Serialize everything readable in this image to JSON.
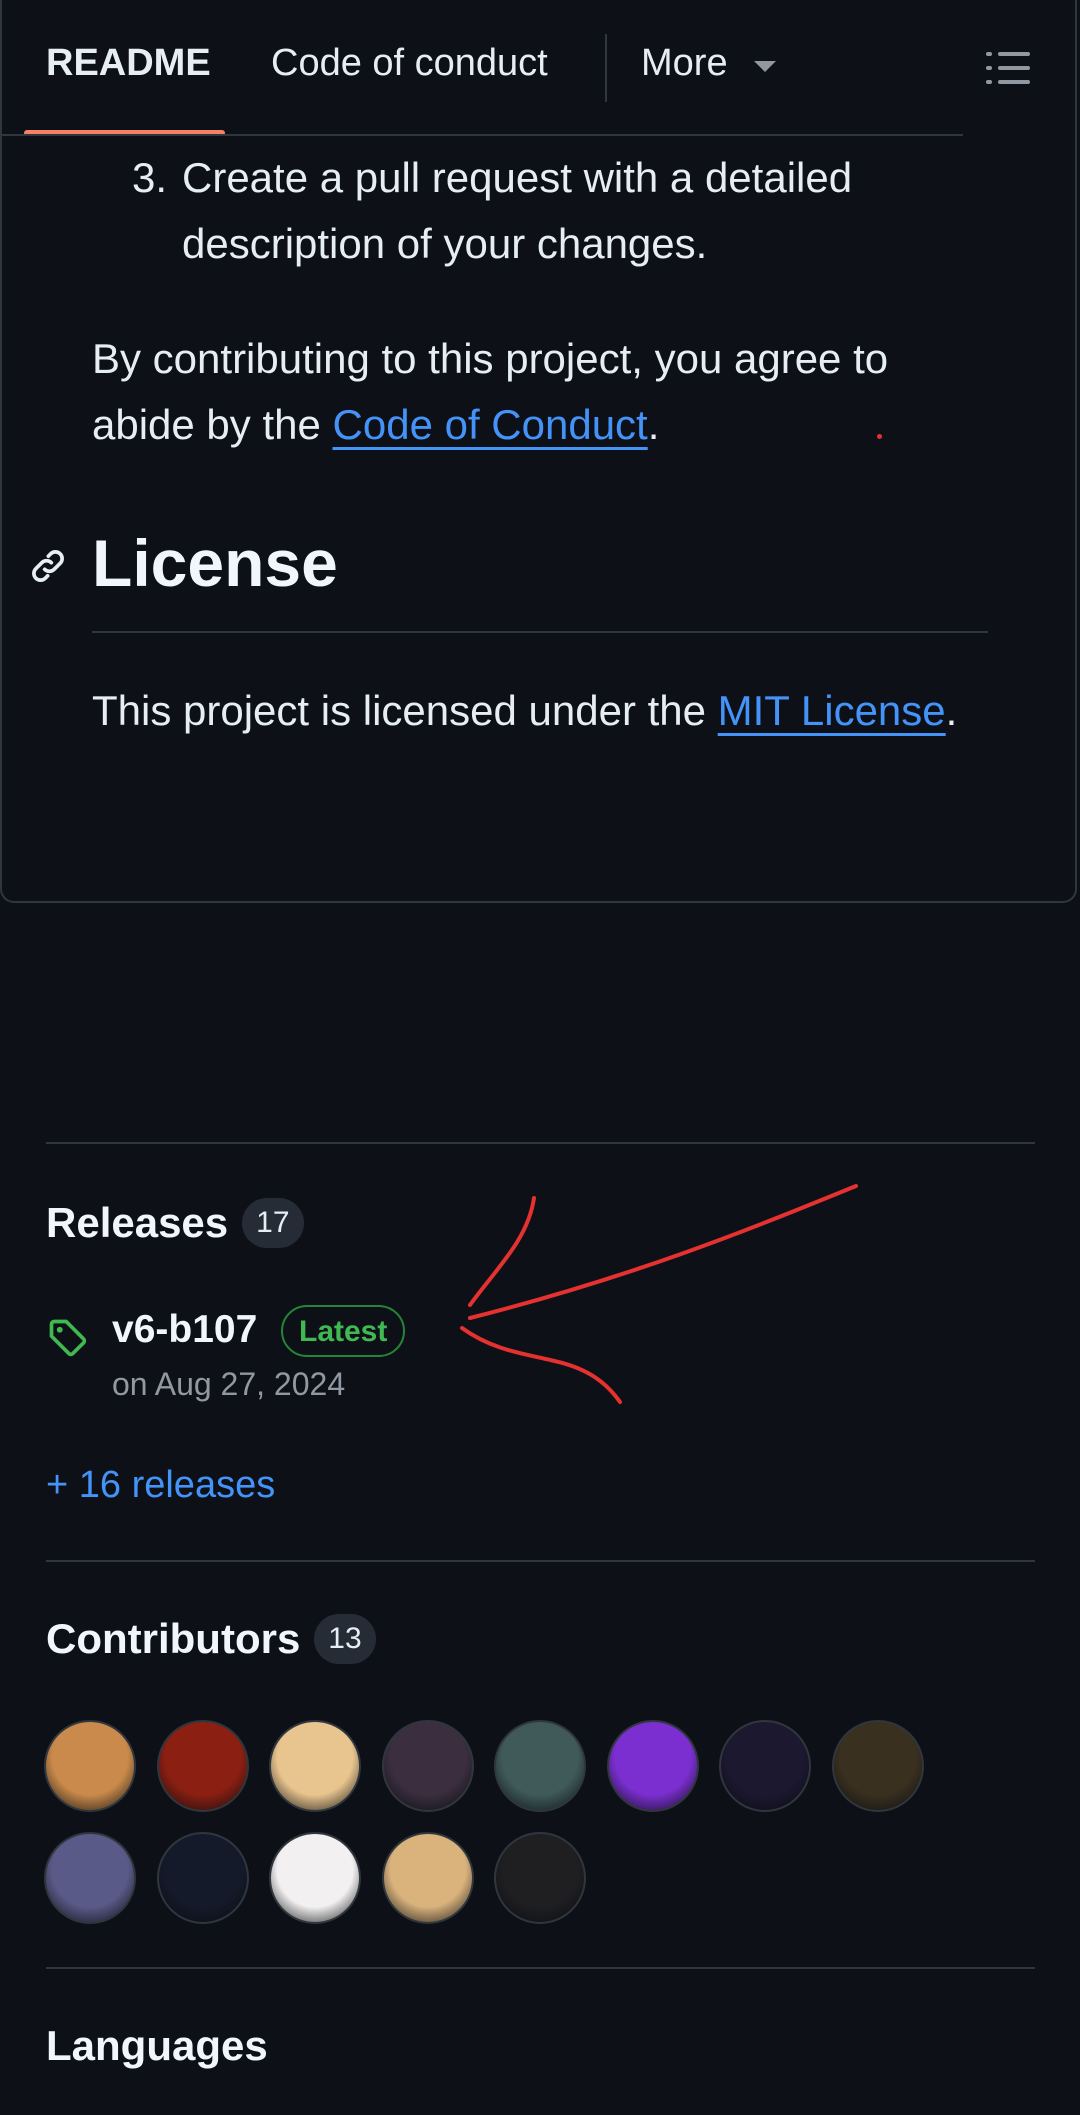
{
  "tabs": {
    "readme": "README",
    "code_of_conduct": "Code of conduct",
    "more": "More"
  },
  "readme": {
    "list_item_number": "3.",
    "list_item_text": "Create a pull request with a detailed description of your changes.",
    "contrib_prefix": "By contributing to this project, you agree to abide by the ",
    "contrib_link": "Code of Conduct",
    "contrib_suffix": ".",
    "license_heading": "License",
    "license_prefix": "This project is licensed under the ",
    "license_link": "MIT License",
    "license_suffix": "."
  },
  "releases": {
    "title": "Releases",
    "count": "17",
    "latest_name": "v6-b107",
    "latest_badge": "Latest",
    "latest_date": "on Aug 27, 2024",
    "more_link": "+ 16 releases"
  },
  "contributors": {
    "title": "Contributors",
    "count": "13",
    "avatars": [
      {
        "name": "contributor-avatar-1",
        "color": "#c98a4b"
      },
      {
        "name": "contributor-avatar-2",
        "color": "#8b1f12"
      },
      {
        "name": "contributor-avatar-3",
        "color": "#e8c48e"
      },
      {
        "name": "contributor-avatar-4",
        "color": "#3a2e3f"
      },
      {
        "name": "contributor-avatar-5",
        "color": "#3f5a58"
      },
      {
        "name": "contributor-avatar-6",
        "color": "#7b2fd0"
      },
      {
        "name": "contributor-avatar-7",
        "color": "#1c1830"
      },
      {
        "name": "contributor-avatar-8",
        "color": "#3a3020"
      },
      {
        "name": "contributor-avatar-9",
        "color": "#5a5a88"
      },
      {
        "name": "contributor-avatar-10",
        "color": "#151a2a"
      },
      {
        "name": "contributor-avatar-11",
        "color": "#f2f0f0"
      },
      {
        "name": "contributor-avatar-12",
        "color": "#d9b27c"
      },
      {
        "name": "contributor-avatar-13",
        "color": "#1f1f22"
      }
    ]
  },
  "languages": {
    "title": "Languages"
  },
  "colors": {
    "background": "#0d1117",
    "link": "#4493f8",
    "tab_accent": "#f78166",
    "latest_green": "#3fb950",
    "annotation_red": "#e5312f"
  }
}
